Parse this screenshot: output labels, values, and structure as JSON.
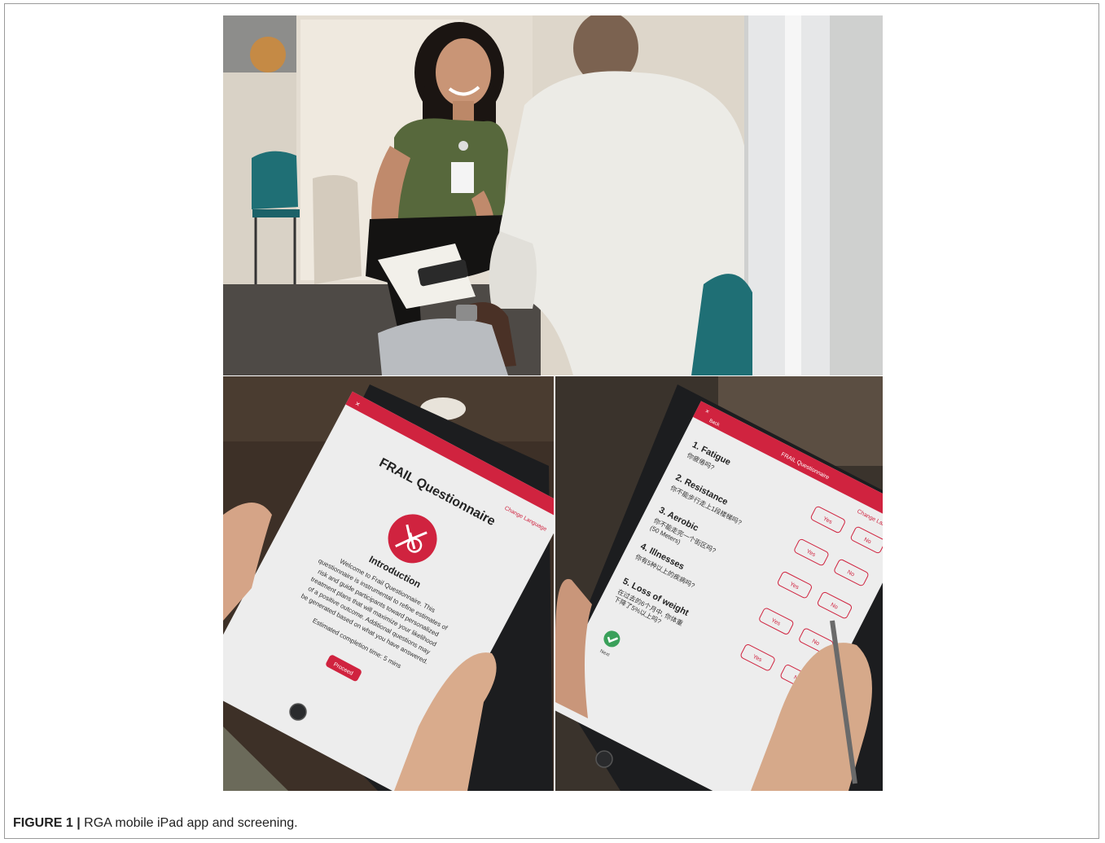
{
  "figure": {
    "label": "FIGURE 1 |",
    "caption": "RGA mobile iPad app and screening."
  },
  "left_tablet": {
    "title": "FRAIL Questionnaire",
    "change_language": "Change Language",
    "section": "Introduction",
    "intro_lines": [
      "Welcome to Frail Questionnaire. This",
      "questionnaire is instrumental to refine estimates of",
      "risk and guide participants toward personalized",
      "treatment plans that will maximize your likelihood",
      "of a positive outcome. Additional questions may",
      "be generated based on what you have answered."
    ],
    "completion": "Estimated completion time: 5 mins",
    "proceed": "Proceed"
  },
  "right_tablet": {
    "header": "FRAIL Questionnaire",
    "back": "Back",
    "change_language": "Change Language",
    "questions": [
      {
        "title": "1. Fatigue",
        "sub": "你疲倦吗?"
      },
      {
        "title": "2. Resistance",
        "sub": "你不能步行走上1段楼梯吗?"
      },
      {
        "title": "3. Aerobic",
        "sub": "你不能走完一个街区吗?",
        "sub2": "(50 Meters)"
      },
      {
        "title": "4. Illnesses",
        "sub": "你有5种以上的疾病吗?"
      },
      {
        "title": "5. Loss of weight",
        "sub": "在过去的6个月中, 你体重",
        "sub2": "下降了5%以上吗?"
      }
    ],
    "yes_label": "Yes",
    "no_label": "No",
    "next": "Next"
  },
  "colors": {
    "app_red": "#d0233f",
    "screen_bg": "#eeeeee"
  }
}
